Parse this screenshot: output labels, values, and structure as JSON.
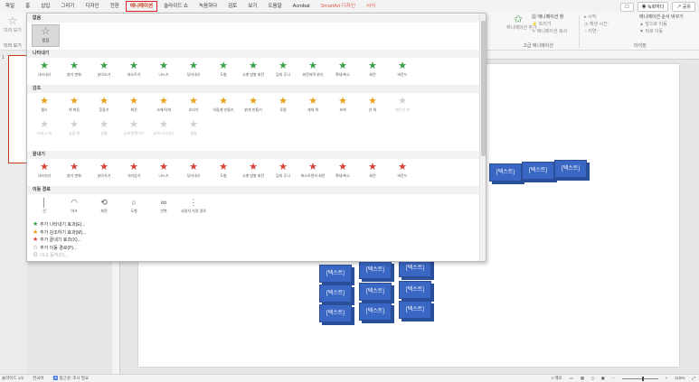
{
  "tabs": [
    "파일",
    "홈",
    "삽입",
    "그리기",
    "디자인",
    "전환",
    "애니메이션",
    "슬라이드 쇼",
    "녹음하다",
    "검토",
    "보기",
    "도움말",
    "Acrobat",
    "SmartArt 디자인",
    "서식"
  ],
  "active_tab": "애니메이션",
  "top_right": {
    "record": "녹화하다",
    "share": "공유"
  },
  "ribbon": {
    "preview": "미리 보기",
    "preview_group": "미리 보기",
    "add_animation": "애니메이션 추가",
    "animation_pane": "애니메이션 창",
    "trigger": "트리거",
    "anim_painter": "애니메이션 복사",
    "advanced_group": "고급 애니메이션",
    "start": "시작:",
    "duration": "재생 시간:",
    "delay": "지연:",
    "timing_group": "타이밍",
    "reorder": "애니메이션 순서 바꾸기",
    "move_earlier": "앞으로 이동",
    "move_later": "뒤로 이동"
  },
  "gallery": {
    "none_header": "없음",
    "none_item": "없음",
    "entrance_header": "나타내기",
    "entrance": [
      "나타내기",
      "밝기 변화",
      "날아오기",
      "떠오르기",
      "나누기",
      "닦아내기",
      "도형",
      "시계 방향 회전",
      "임의 무늬",
      "회전하며 밝기",
      "확대/축소",
      "회전",
      "바운드"
    ],
    "emphasis_header": "강조",
    "emphasis": [
      "펄스",
      "색 파동",
      "흔들기",
      "회전",
      "크게/작게",
      "흐리기",
      "어둡게 만들기",
      "밝게 만들기",
      "투명",
      "개체 색",
      "보색",
      "선 색",
      "채우기 색",
      "브러시 색",
      "글꼴 색",
      "밑줄",
      "굵게 번쩍이기",
      "굵게 나타내기",
      "물결"
    ],
    "emphasis_disabled_from": 12,
    "exit_header": "끝내기",
    "exit": [
      "사라지기",
      "밝기 변화",
      "날아가기",
      "가라앉기",
      "나누기",
      "닦아내기",
      "도형",
      "시계 방향 회전",
      "임의 무늬",
      "축소하면서 회전",
      "확대/축소",
      "회전",
      "바운드"
    ],
    "paths_header": "이동 경로",
    "paths": [
      "선",
      "아크",
      "회전",
      "도형",
      "반복",
      "사용자 지정 경로"
    ],
    "more": [
      "추가 나타내기 효과(E)...",
      "추가 강조하기 효과(M)...",
      "추가 끝내기 효과(X)...",
      "추가 이동 경로(P)...",
      "OLE 동작(O)..."
    ]
  },
  "slide": {
    "block_label": "[텍스트]"
  },
  "status": {
    "slide_count": "슬라이드 1/2",
    "language": "한국어",
    "accessibility": "접근성: 조사 필요",
    "notes": "메모",
    "zoom": "115%"
  },
  "colors": {
    "accent": "#c43e1c",
    "entrance": "#3aa04a",
    "emphasis": "#e8a21a",
    "exit": "#d8403a",
    "smartart": "#3a67c4"
  }
}
